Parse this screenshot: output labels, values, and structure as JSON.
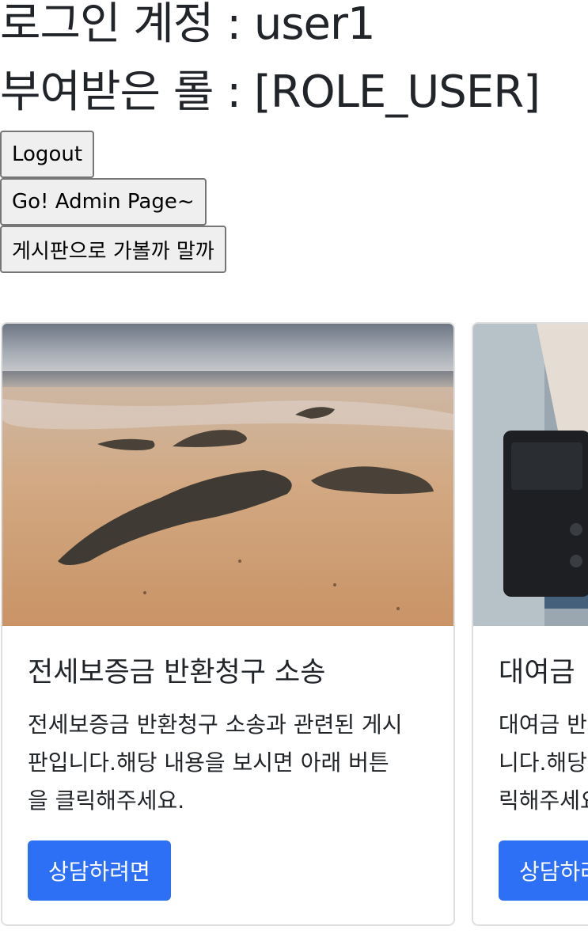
{
  "account": {
    "login_line": "로그인 계정 : user1",
    "role_line": "부여받은 롤 : [ROLE_USER]"
  },
  "buttons": {
    "logout": "Logout",
    "admin": "Go! Admin Page~",
    "board": "게시판으로 가볼까 말까"
  },
  "cards": [
    {
      "title": "전세보증금 반환청구 소송",
      "text": "전세보증금 반환청구 소송과 관련된 게시\n판입니다.해당 내용을 보시면 아래 버튼\n을 클릭해주세요.",
      "button": "상담하려면",
      "image": "beach-seaweed-photo"
    },
    {
      "title": "대여금",
      "text": "대여금 반\n니다.해당\n릭해주세요.",
      "button": "상담하려면",
      "image": "camera-person-photo"
    }
  ],
  "colors": {
    "primary": "#2d6ff5",
    "text": "#212529"
  }
}
